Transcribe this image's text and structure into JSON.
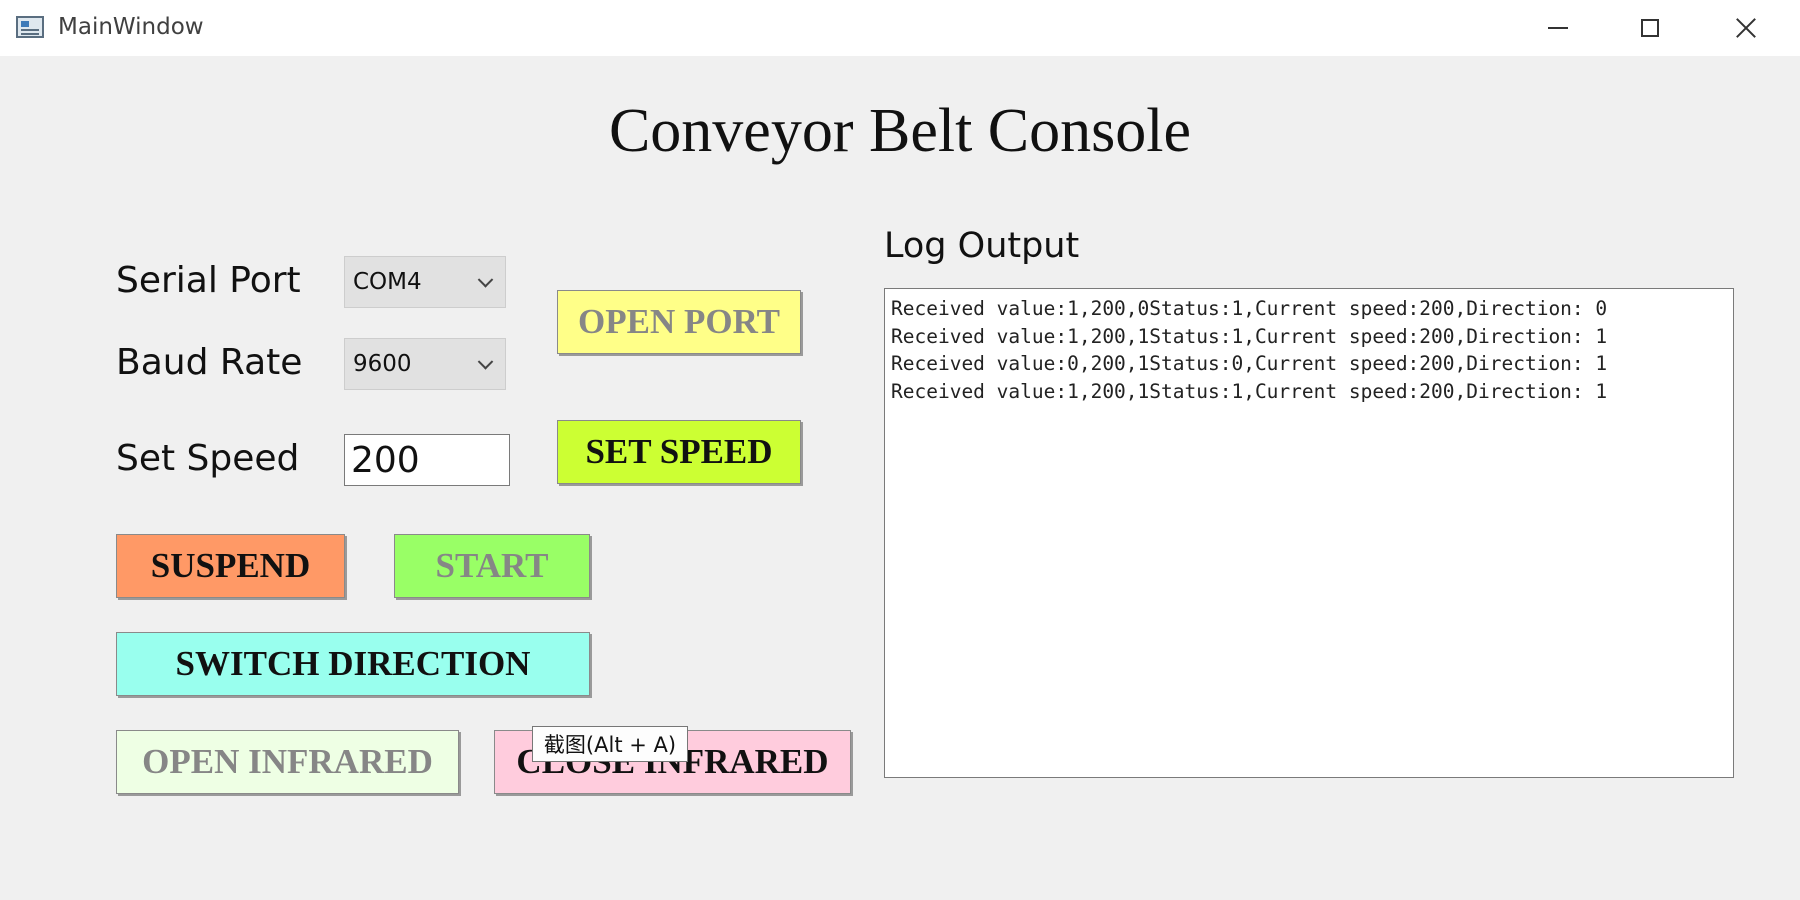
{
  "window": {
    "title": "MainWindow"
  },
  "heading": "Conveyor Belt Console",
  "serial_port": {
    "label": "Serial Port",
    "selected": "COM4"
  },
  "baud_rate": {
    "label": "Baud Rate",
    "selected": "9600"
  },
  "set_speed": {
    "label": "Set Speed",
    "value": "200"
  },
  "buttons": {
    "open_port": "OPEN PORT",
    "set_speed": "SET SPEED",
    "suspend": "SUSPEND",
    "start": "START",
    "switch_direction": "SWITCH DIRECTION",
    "open_infrared": "OPEN INFRARED",
    "close_infrared": "CLOSE INFRARED"
  },
  "colors": {
    "open_port": "#ffff88",
    "set_speed": "#ccff33",
    "suspend": "#ff9966",
    "start": "#99ff66",
    "switch_direction": "#99ffee",
    "open_infrared": "#eeffe4",
    "close_infrared": "#ffccdd"
  },
  "log": {
    "title": "Log Output",
    "lines": [
      "Received value:1,200,0Status:1,Current speed:200,Direction: 0",
      "Received value:1,200,1Status:1,Current speed:200,Direction: 1",
      "Received value:0,200,1Status:0,Current speed:200,Direction: 1",
      "Received value:1,200,1Status:1,Current speed:200,Direction: 1"
    ]
  },
  "tooltip": "截图(Alt + A)"
}
